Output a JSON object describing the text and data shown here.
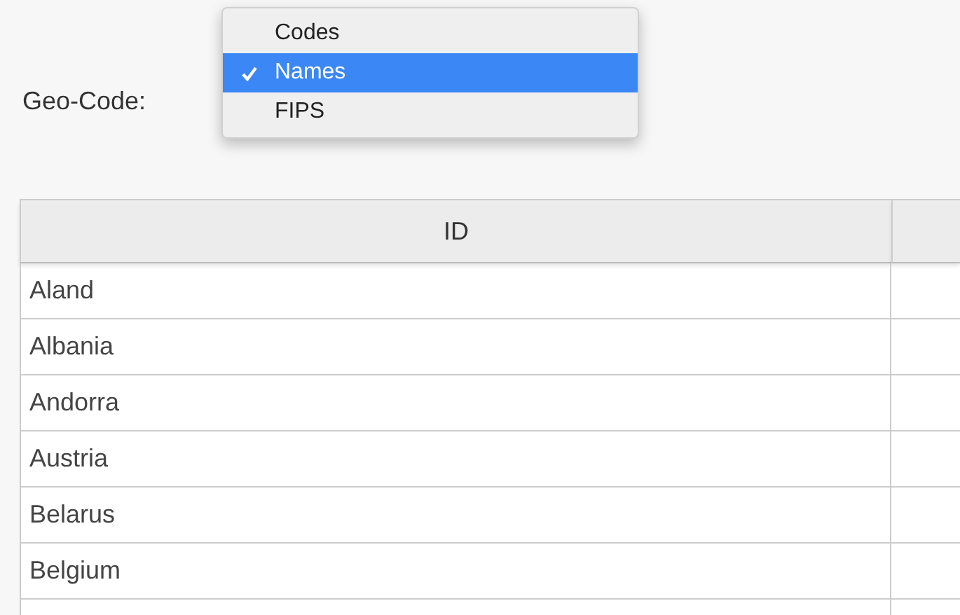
{
  "geo_code": {
    "label": "Geo-Code:",
    "options": [
      {
        "label": "Codes",
        "selected": false
      },
      {
        "label": "Names",
        "selected": true
      },
      {
        "label": "FIPS",
        "selected": false
      }
    ]
  },
  "table": {
    "columns": [
      "ID",
      ""
    ],
    "rows": [
      [
        "Aland"
      ],
      [
        "Albania"
      ],
      [
        "Andorra"
      ],
      [
        "Austria"
      ],
      [
        "Belarus"
      ],
      [
        "Belgium"
      ]
    ]
  }
}
